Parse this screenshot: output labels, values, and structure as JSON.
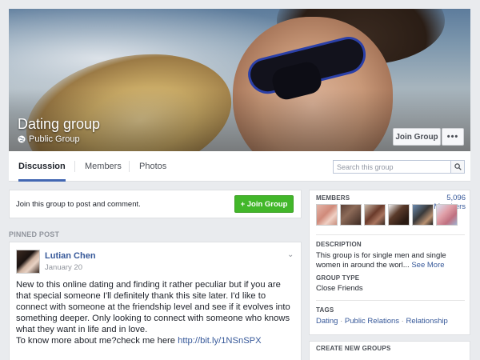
{
  "group": {
    "name": "Dating group",
    "privacy": "Public Group",
    "join_label": "Join Group",
    "more_label": "•••",
    "privacy_icon": "globe-icon"
  },
  "tabs": [
    {
      "label": "Discussion",
      "active": true
    },
    {
      "label": "Members",
      "active": false
    },
    {
      "label": "Photos",
      "active": false
    }
  ],
  "search": {
    "placeholder": "Search this group",
    "icon": "search-icon"
  },
  "join_card": {
    "prompt": "Join this group to post and comment.",
    "button_label": "+ Join Group"
  },
  "pinned": {
    "label": "PINNED POST"
  },
  "post": {
    "author": "Lutian Chen",
    "date": "January 20",
    "lines": [
      "New to this online dating and finding it rather peculiar but if you are that special someone I'll definitely thank this site later. I'd like to connect with someone at the friendship level and see if it evolves into something deeper. Only looking to connect with someone who knows what they want in life and in love."
    ],
    "link_prefix": "To know more about me?check me here ",
    "link_text": "http://bit.ly/1NSnSPX"
  },
  "sidebar": {
    "members_label": "MEMBERS",
    "members_count": "5,096 Members",
    "description_label": "DESCRIPTION",
    "description": "This group is for single men and single women in around the worl...",
    "see_more": "See More",
    "group_type_label": "GROUP TYPE",
    "group_type": "Close Friends",
    "tags_label": "TAGS",
    "tags": [
      "Dating",
      "Public Relations",
      "Relationship"
    ],
    "tag_separator": " · ",
    "create_label": "CREATE NEW GROUPS"
  },
  "colors": {
    "link": "#365899",
    "join_green": "#42b72a",
    "tab_active": "#4267b2",
    "background": "#e9ebee"
  }
}
